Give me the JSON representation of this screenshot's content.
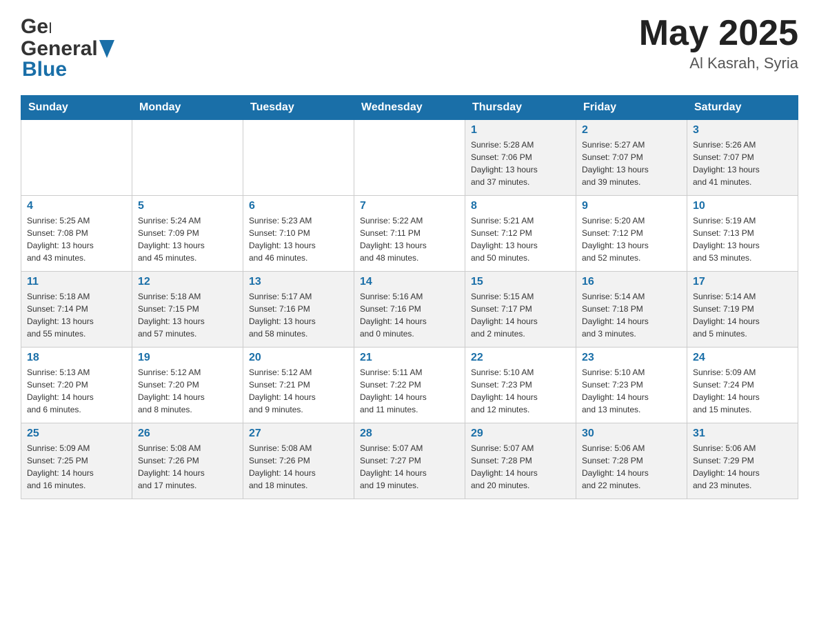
{
  "header": {
    "logo_general": "General",
    "logo_blue": "Blue",
    "month_year": "May 2025",
    "location": "Al Kasrah, Syria"
  },
  "weekdays": [
    "Sunday",
    "Monday",
    "Tuesday",
    "Wednesday",
    "Thursday",
    "Friday",
    "Saturday"
  ],
  "rows": [
    {
      "cells": [
        {
          "day": "",
          "info": ""
        },
        {
          "day": "",
          "info": ""
        },
        {
          "day": "",
          "info": ""
        },
        {
          "day": "",
          "info": ""
        },
        {
          "day": "1",
          "info": "Sunrise: 5:28 AM\nSunset: 7:06 PM\nDaylight: 13 hours\nand 37 minutes."
        },
        {
          "day": "2",
          "info": "Sunrise: 5:27 AM\nSunset: 7:07 PM\nDaylight: 13 hours\nand 39 minutes."
        },
        {
          "day": "3",
          "info": "Sunrise: 5:26 AM\nSunset: 7:07 PM\nDaylight: 13 hours\nand 41 minutes."
        }
      ]
    },
    {
      "cells": [
        {
          "day": "4",
          "info": "Sunrise: 5:25 AM\nSunset: 7:08 PM\nDaylight: 13 hours\nand 43 minutes."
        },
        {
          "day": "5",
          "info": "Sunrise: 5:24 AM\nSunset: 7:09 PM\nDaylight: 13 hours\nand 45 minutes."
        },
        {
          "day": "6",
          "info": "Sunrise: 5:23 AM\nSunset: 7:10 PM\nDaylight: 13 hours\nand 46 minutes."
        },
        {
          "day": "7",
          "info": "Sunrise: 5:22 AM\nSunset: 7:11 PM\nDaylight: 13 hours\nand 48 minutes."
        },
        {
          "day": "8",
          "info": "Sunrise: 5:21 AM\nSunset: 7:12 PM\nDaylight: 13 hours\nand 50 minutes."
        },
        {
          "day": "9",
          "info": "Sunrise: 5:20 AM\nSunset: 7:12 PM\nDaylight: 13 hours\nand 52 minutes."
        },
        {
          "day": "10",
          "info": "Sunrise: 5:19 AM\nSunset: 7:13 PM\nDaylight: 13 hours\nand 53 minutes."
        }
      ]
    },
    {
      "cells": [
        {
          "day": "11",
          "info": "Sunrise: 5:18 AM\nSunset: 7:14 PM\nDaylight: 13 hours\nand 55 minutes."
        },
        {
          "day": "12",
          "info": "Sunrise: 5:18 AM\nSunset: 7:15 PM\nDaylight: 13 hours\nand 57 minutes."
        },
        {
          "day": "13",
          "info": "Sunrise: 5:17 AM\nSunset: 7:16 PM\nDaylight: 13 hours\nand 58 minutes."
        },
        {
          "day": "14",
          "info": "Sunrise: 5:16 AM\nSunset: 7:16 PM\nDaylight: 14 hours\nand 0 minutes."
        },
        {
          "day": "15",
          "info": "Sunrise: 5:15 AM\nSunset: 7:17 PM\nDaylight: 14 hours\nand 2 minutes."
        },
        {
          "day": "16",
          "info": "Sunrise: 5:14 AM\nSunset: 7:18 PM\nDaylight: 14 hours\nand 3 minutes."
        },
        {
          "day": "17",
          "info": "Sunrise: 5:14 AM\nSunset: 7:19 PM\nDaylight: 14 hours\nand 5 minutes."
        }
      ]
    },
    {
      "cells": [
        {
          "day": "18",
          "info": "Sunrise: 5:13 AM\nSunset: 7:20 PM\nDaylight: 14 hours\nand 6 minutes."
        },
        {
          "day": "19",
          "info": "Sunrise: 5:12 AM\nSunset: 7:20 PM\nDaylight: 14 hours\nand 8 minutes."
        },
        {
          "day": "20",
          "info": "Sunrise: 5:12 AM\nSunset: 7:21 PM\nDaylight: 14 hours\nand 9 minutes."
        },
        {
          "day": "21",
          "info": "Sunrise: 5:11 AM\nSunset: 7:22 PM\nDaylight: 14 hours\nand 11 minutes."
        },
        {
          "day": "22",
          "info": "Sunrise: 5:10 AM\nSunset: 7:23 PM\nDaylight: 14 hours\nand 12 minutes."
        },
        {
          "day": "23",
          "info": "Sunrise: 5:10 AM\nSunset: 7:23 PM\nDaylight: 14 hours\nand 13 minutes."
        },
        {
          "day": "24",
          "info": "Sunrise: 5:09 AM\nSunset: 7:24 PM\nDaylight: 14 hours\nand 15 minutes."
        }
      ]
    },
    {
      "cells": [
        {
          "day": "25",
          "info": "Sunrise: 5:09 AM\nSunset: 7:25 PM\nDaylight: 14 hours\nand 16 minutes."
        },
        {
          "day": "26",
          "info": "Sunrise: 5:08 AM\nSunset: 7:26 PM\nDaylight: 14 hours\nand 17 minutes."
        },
        {
          "day": "27",
          "info": "Sunrise: 5:08 AM\nSunset: 7:26 PM\nDaylight: 14 hours\nand 18 minutes."
        },
        {
          "day": "28",
          "info": "Sunrise: 5:07 AM\nSunset: 7:27 PM\nDaylight: 14 hours\nand 19 minutes."
        },
        {
          "day": "29",
          "info": "Sunrise: 5:07 AM\nSunset: 7:28 PM\nDaylight: 14 hours\nand 20 minutes."
        },
        {
          "day": "30",
          "info": "Sunrise: 5:06 AM\nSunset: 7:28 PM\nDaylight: 14 hours\nand 22 minutes."
        },
        {
          "day": "31",
          "info": "Sunrise: 5:06 AM\nSunset: 7:29 PM\nDaylight: 14 hours\nand 23 minutes."
        }
      ]
    }
  ]
}
